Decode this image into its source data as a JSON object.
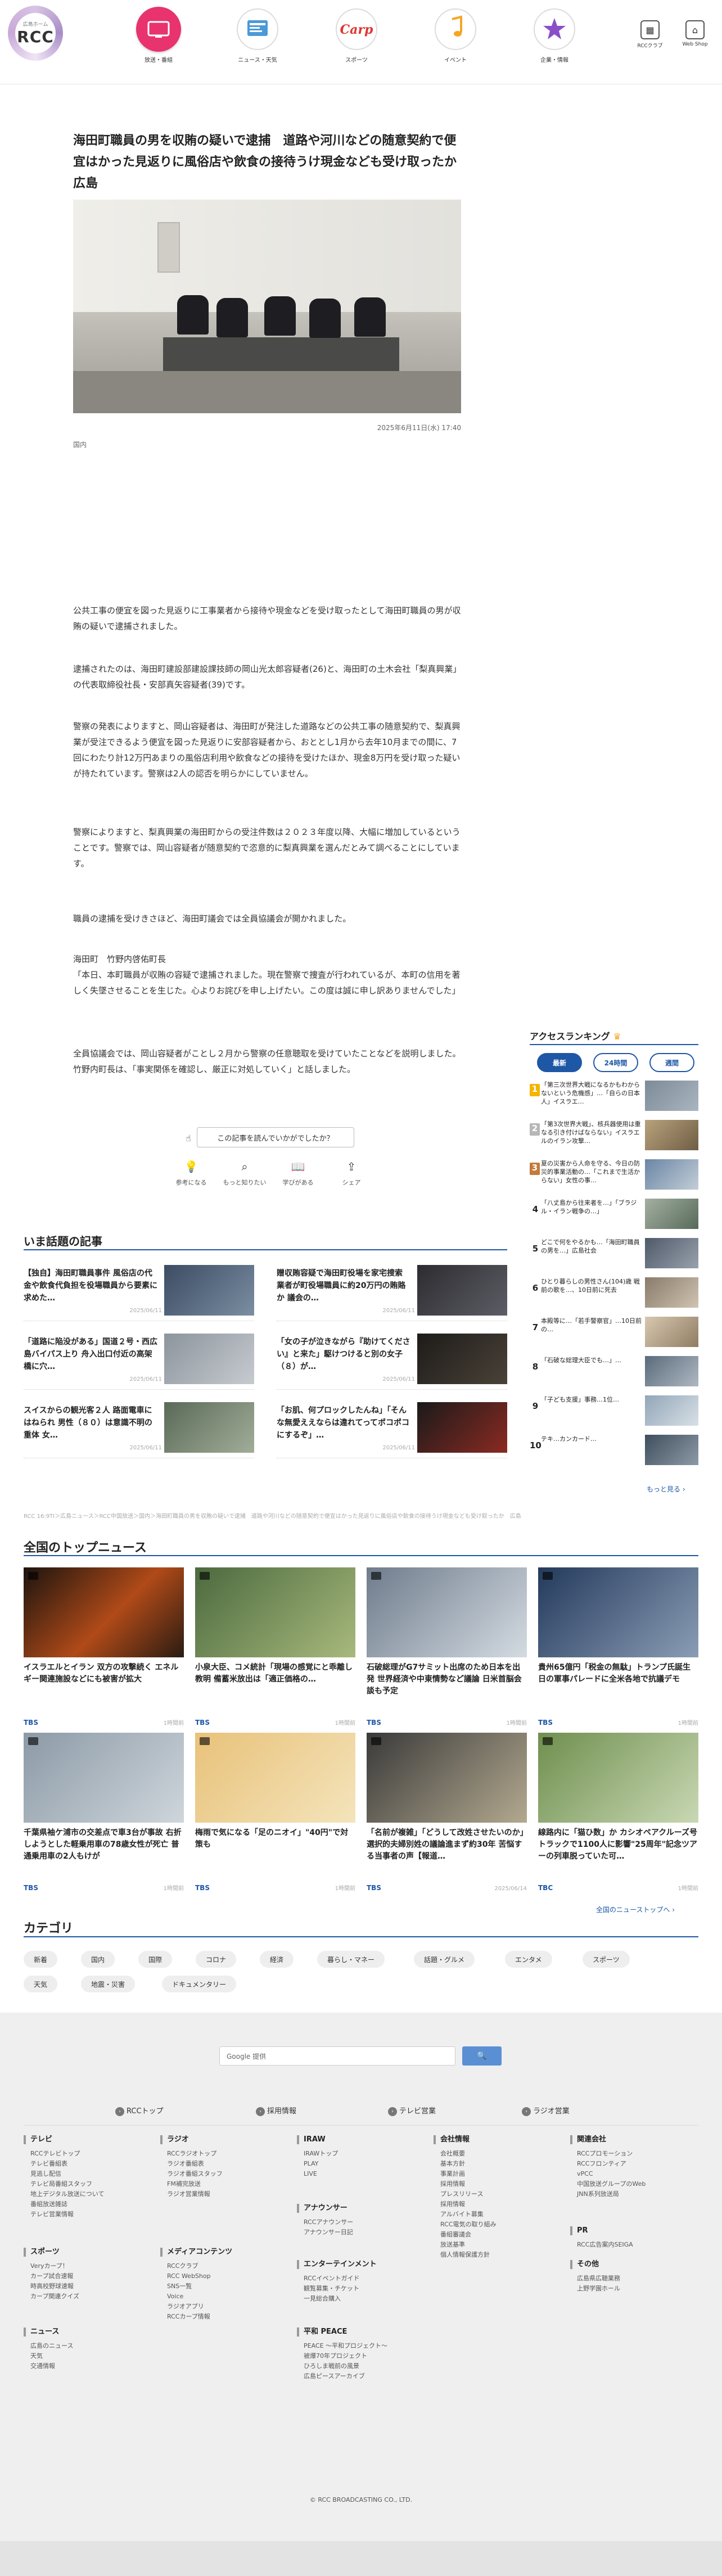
{
  "header": {
    "logo_small": "広島ホーム",
    "logo_text": "RCC",
    "nav": [
      {
        "label": "放送・番組",
        "icon": "tv-icon",
        "color": "#e8336e"
      },
      {
        "label": "ニュース・天気",
        "icon": "news-icon",
        "color": "#4a9ad8"
      },
      {
        "label": "スポーツ",
        "icon": "carp-icon",
        "color": "#e0332f"
      },
      {
        "label": "イベント",
        "icon": "music-note-icon",
        "color": "#f5a623"
      },
      {
        "label": "企業・情報",
        "icon": "star-icon",
        "color": "#8a4fc8"
      }
    ],
    "util": [
      {
        "label": "RCCクラブ",
        "icon": "grid-icon"
      },
      {
        "label": "Web Shop",
        "icon": "shop-icon"
      }
    ]
  },
  "article": {
    "title": "海田町職員の男を収賄の疑いで逮捕　道路や河川などの随意契約で便宜はかった見返りに風俗店や飲食の接待うけ現金なども受け取ったか　広島",
    "date": "2025年6月11日(水) 17:40",
    "category": "国内",
    "paragraphs": [
      "公共工事の便宜を図った見返りに工事業者から接待や現金などを受け取ったとして海田町職員の男が収賄の疑いで逮捕されました。",
      "逮捕されたのは、海田町建設部建設課技師の岡山光太郎容疑者(26)と、海田町の土木会社「梨真興業」の代表取締役社長・安部真矢容疑者(39)です。",
      "警察の発表によりますと、岡山容疑者は、海田町が発注した道路などの公共工事の随意契約で、梨真興業が受注できるよう便宜を図った見返りに安部容疑者から、おととし1月から去年10月までの間に、7回にわたり計12万円あまりの風俗店利用や飲食などの接待を受けたほか、現金8万円を受け取った疑いが持たれています。警察は2人の認否を明らかにしていません。",
      "警察によりますと、梨真興業の海田町からの受注件数は２０２３年度以降、大幅に増加しているということです。警察では、岡山容疑者が随意契約で恣意的に梨真興業を選んだとみて調べることにしています。",
      "職員の逮捕を受けきさほど、海田町議会では全員協議会が開かれました。",
      "海田町　竹野内啓佑町長\n「本日、本町職員が収賄の容疑で逮捕されました。現在警察で捜査が行われているが、本町の信用を著しく失墜させることを生じた。心よりお詫びを申し上げたい。この度は誠に申し訳ありませんでした」",
      "全員協議会では、岡山容疑者がことし２月から警察の任意聴取を受けていたことなどを説明しました。竹野内町長は、「事実関係を確認し、厳正に対処していく」と話しました。"
    ],
    "feedback": {
      "button": "この記事を読んでいかがでしたか？",
      "options": [
        {
          "label": "参考になる",
          "icon": "bulb-icon"
        },
        {
          "label": "もっと知りたい",
          "icon": "magnifier-icon"
        },
        {
          "label": "学びがある",
          "icon": "book-icon"
        },
        {
          "label": "シェア",
          "icon": "share-icon"
        }
      ]
    }
  },
  "ranking": {
    "title": "アクセスランキング",
    "tabs": [
      "最新",
      "24時間",
      "週間"
    ],
    "items": [
      {
        "num": "",
        "text": "「第三次世界大戦になるかもわからないという危機感」…「自らの日本人」イスラエ…"
      },
      {
        "num": "",
        "text": "「第3次世界大戦」、核兵器使用は重なる引き付けばならない」イスラエルのイラン攻撃…"
      },
      {
        "num": "",
        "text": "夏の災害から人命を守る、今日の防災的事業活動の…「これまで生活からない」女性の事…"
      },
      {
        "num": "",
        "text": "「八丈島から往来者を…」「ブラジル・イラン戦争の…」"
      },
      {
        "num": "",
        "text": "どこで何をやるかも…「海田町職員の男を…」広島社会"
      },
      {
        "num": "6",
        "text": "ひとり暮らしの男性さん(104)歳 戦前の歌を…、10日前に死去"
      },
      {
        "num": "7",
        "text": "本殿等に…「若手警察官」…10日前の…"
      },
      {
        "num": "8",
        "text": "「石破な総理大臣でも…」…"
      },
      {
        "num": "9",
        "text": "「子ども支援」事務…1位…"
      },
      {
        "num": "10",
        "text": "テキ…カンカード…"
      }
    ],
    "more": "もっと見る ›"
  },
  "hot": {
    "title": "いま話題の記事",
    "items": [
      {
        "text": "【独自】海田町職員事件 風俗店の代金や飲食代負担を役場職員から要素に求めた…",
        "date": "2025/06/11"
      },
      {
        "text": "贈収賄容疑で海田町役場を家宅捜索 業者が町役場職員に約20万円の賄賂か 議会の…",
        "date": "2025/06/11"
      },
      {
        "text": "「道路に陥没がある」国道２号・西広島バイパス上り 舟入出口付近の高架橋に穴…",
        "date": "2025/06/11"
      },
      {
        "text": "「女の子が泣きながら『助けてください』と来た」駆けつけると別の女子（８）が…",
        "date": "2025/06/11"
      },
      {
        "text": "スイスからの観光客２人 路面電車にはねられ 男性（８０）は意識不明の重体 女…",
        "date": "2025/06/11"
      },
      {
        "text": "「お肌、何プロックしたんね」「そんな無愛ええならは違れてってポコポコにするぞ」…",
        "date": "2025/06/11"
      }
    ]
  },
  "breadcrumb": "RCC 16:9TI＞広島ニュース＞RCC中国放送＞国内＞海田町職員の男を収賄の疑いで逮捕　道路や河川などの随意契約で便宜はかった見返りに風俗店や飲食の接待うけ現金なども受け取ったか　広島",
  "national": {
    "title": "全国のトップニュース",
    "items": [
      {
        "text": "イスラエルとイラン 双方の攻撃続く エネルギー関連施設などにも被害が拡大",
        "src": "TBS",
        "date": "1時間前"
      },
      {
        "text": "小泉大臣、コメ統計「現場の感覚にと乖離し教明 備蓄米放出は「適正価格の…",
        "src": "TBS",
        "date": "1時間前"
      },
      {
        "text": "石破総理がG7サミット出席のため日本を出発 世界経済や中東情勢など議論 日米首脳会談も予定",
        "src": "TBS",
        "date": "1時間前"
      },
      {
        "text": "貴州65億円「税金の無駄」トランプ氏誕生日の軍事パレードに全米各地で抗議デモ",
        "src": "TBS",
        "date": "1時間前"
      },
      {
        "text": "千葉県袖ケ浦市の交差点で車3台が事故 右折しようとした軽乗用車の78歳女性が死亡 普通乗用車の2人もけが",
        "src": "TBS",
        "date": "1時間前"
      },
      {
        "text": "梅雨で気になる「足のニオイ」\"40円\"で対策も",
        "src": "TBS",
        "date": "1時間前"
      },
      {
        "text": "「名前が複雑」「どうして改姓させたいのか」選択的夫婦別姓の議論進まず約30年 苦悩する当事者の声【報道…",
        "src": "TBS",
        "date": "2025/06/14"
      },
      {
        "text": "線路内に「猫ひ数」か カシオペアクルーズ号トラックで1100人に影響\"25周年\"記念ツアーの列車脱っていた可…",
        "src": "TBC",
        "date": "1時間前"
      }
    ],
    "more": "全国のニューストップへ ›"
  },
  "category": {
    "title": "カテゴリ",
    "chips": [
      "新着",
      "国内",
      "国際",
      "コロナ",
      "経済",
      "暮らし・マネー",
      "話題・グルメ",
      "エンタメ",
      "スポーツ",
      "天気",
      "地震・災害",
      "ドキュメンタリー"
    ]
  },
  "footer": {
    "search_placeholder": "Google 提供",
    "search_button": "🔍",
    "links": [
      "RCCトップ",
      "採用情報",
      "テレビ営業",
      "ラジオ営業"
    ],
    "columns": [
      {
        "heading": "テレビ",
        "items": [
          "RCCテレビトップ",
          "テレビ番組表",
          "見逃し配信",
          "テレビ局番組スタッフ",
          "地上デジタル放送について",
          "番組放送雑誌",
          "テレビ営業情報"
        ]
      },
      {
        "heading": "スポーツ",
        "items": [
          "Veryカープ！",
          "カープ試合速報",
          "時高校野球速報",
          "カープ関連クイズ"
        ]
      },
      {
        "heading": "ニュース",
        "items": [
          "広島のニュース",
          "天気",
          "交通情報"
        ]
      },
      {
        "heading": "ラジオ",
        "items": [
          "RCCラジオトップ",
          "ラジオ番組表",
          "ラジオ番組スタッフ",
          "FM補完放送",
          "ラジオ営業情報"
        ]
      },
      {
        "heading": "メディアコンテンツ",
        "items": [
          "RCCクラブ",
          "RCC WebShop",
          "SNS一覧",
          "Voice",
          "ラジオアプリ",
          "RCCカープ情報"
        ]
      },
      {
        "heading": "IRAW",
        "items": [
          "IRAWトップ",
          "PLAY",
          "LIVE"
        ]
      },
      {
        "heading": "アナウンサー",
        "items": [
          "RCCアナウンサー",
          "アナウンサー日記"
        ]
      },
      {
        "heading": "エンターテインメント",
        "items": [
          "RCCイベントガイド",
          "観覧募集・チケット",
          "一見総合購入"
        ]
      },
      {
        "heading": "平和 PEACE",
        "items": [
          "PEACE ～平和プロジェクト～",
          "被爆70年プロジェクト",
          "ひろしま戦前の風景",
          "広島ピースアーカイブ"
        ]
      },
      {
        "heading": "会社情報",
        "items": [
          "会社概要",
          "基本方針",
          "事業計画",
          "採用情報",
          "プレスリリース",
          "採用情報",
          "アルバイト募集",
          "RCC電気の取り組み",
          "番組審議会",
          "放送基準",
          "個人情報保護方針"
        ]
      },
      {
        "heading": "関連会社",
        "items": [
          "RCCプロモーション",
          "RCCフロンティア",
          "vPCC",
          "中国放送グループのWeb",
          "JNN系列放送局"
        ]
      },
      {
        "heading": "PR",
        "items": [
          "RCC広告案内SEIGA"
        ]
      },
      {
        "heading": "その他",
        "items": [
          "広島県広聴業務",
          "上野学園ホール"
        ]
      }
    ],
    "copyright": "© RCC BROADCASTING CO., LTD."
  }
}
